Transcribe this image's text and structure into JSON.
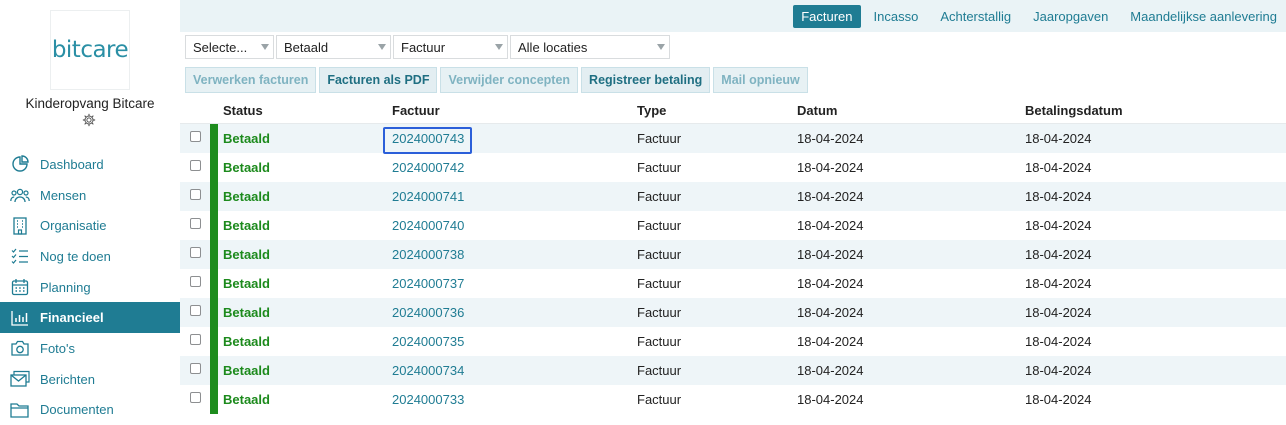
{
  "sidebar": {
    "logo_text": "bitcare",
    "org_name": "Kinderopvang Bitcare",
    "nav": [
      {
        "label": "Dashboard",
        "icon": "dashboard-icon"
      },
      {
        "label": "Mensen",
        "icon": "people-icon"
      },
      {
        "label": "Organisatie",
        "icon": "building-icon"
      },
      {
        "label": "Nog te doen",
        "icon": "checklist-icon"
      },
      {
        "label": "Planning",
        "icon": "calendar-icon"
      },
      {
        "label": "Financieel",
        "icon": "bar-chart-icon",
        "active": true
      },
      {
        "label": "Foto's",
        "icon": "camera-icon"
      },
      {
        "label": "Berichten",
        "icon": "envelope-icon"
      },
      {
        "label": "Documenten",
        "icon": "folder-icon"
      }
    ]
  },
  "tabs": [
    {
      "label": "Facturen",
      "active": true
    },
    {
      "label": "Incasso"
    },
    {
      "label": "Achterstallig"
    },
    {
      "label": "Jaaropgaven"
    },
    {
      "label": "Maandelijkse aanlevering"
    }
  ],
  "filters": {
    "select1": "Selecte...",
    "select2": "Betaald",
    "select3": "Factuur",
    "select4": "Alle locaties"
  },
  "actions": {
    "verwerken": "Verwerken facturen",
    "pdf": "Facturen als PDF",
    "verwijder": "Verwijder concepten",
    "registreer": "Registreer betaling",
    "mail": "Mail opnieuw"
  },
  "table": {
    "headers": {
      "status": "Status",
      "factuur": "Factuur",
      "type": "Type",
      "datum": "Datum",
      "betalingsdatum": "Betalingsdatum"
    },
    "rows": [
      {
        "status": "Betaald",
        "factuur": "2024000743",
        "type": "Factuur",
        "datum": "18-04-2024",
        "betalingsdatum": "18-04-2024"
      },
      {
        "status": "Betaald",
        "factuur": "2024000742",
        "type": "Factuur",
        "datum": "18-04-2024",
        "betalingsdatum": "18-04-2024"
      },
      {
        "status": "Betaald",
        "factuur": "2024000741",
        "type": "Factuur",
        "datum": "18-04-2024",
        "betalingsdatum": "18-04-2024"
      },
      {
        "status": "Betaald",
        "factuur": "2024000740",
        "type": "Factuur",
        "datum": "18-04-2024",
        "betalingsdatum": "18-04-2024"
      },
      {
        "status": "Betaald",
        "factuur": "2024000738",
        "type": "Factuur",
        "datum": "18-04-2024",
        "betalingsdatum": "18-04-2024"
      },
      {
        "status": "Betaald",
        "factuur": "2024000737",
        "type": "Factuur",
        "datum": "18-04-2024",
        "betalingsdatum": "18-04-2024"
      },
      {
        "status": "Betaald",
        "factuur": "2024000736",
        "type": "Factuur",
        "datum": "18-04-2024",
        "betalingsdatum": "18-04-2024"
      },
      {
        "status": "Betaald",
        "factuur": "2024000735",
        "type": "Factuur",
        "datum": "18-04-2024",
        "betalingsdatum": "18-04-2024"
      },
      {
        "status": "Betaald",
        "factuur": "2024000734",
        "type": "Factuur",
        "datum": "18-04-2024",
        "betalingsdatum": "18-04-2024"
      },
      {
        "status": "Betaald",
        "factuur": "2024000733",
        "type": "Factuur",
        "datum": "18-04-2024",
        "betalingsdatum": "18-04-2024"
      }
    ]
  },
  "colors": {
    "accent": "#1f7c93",
    "paid": "#1e8c1e",
    "focus": "#2b5fd9"
  }
}
